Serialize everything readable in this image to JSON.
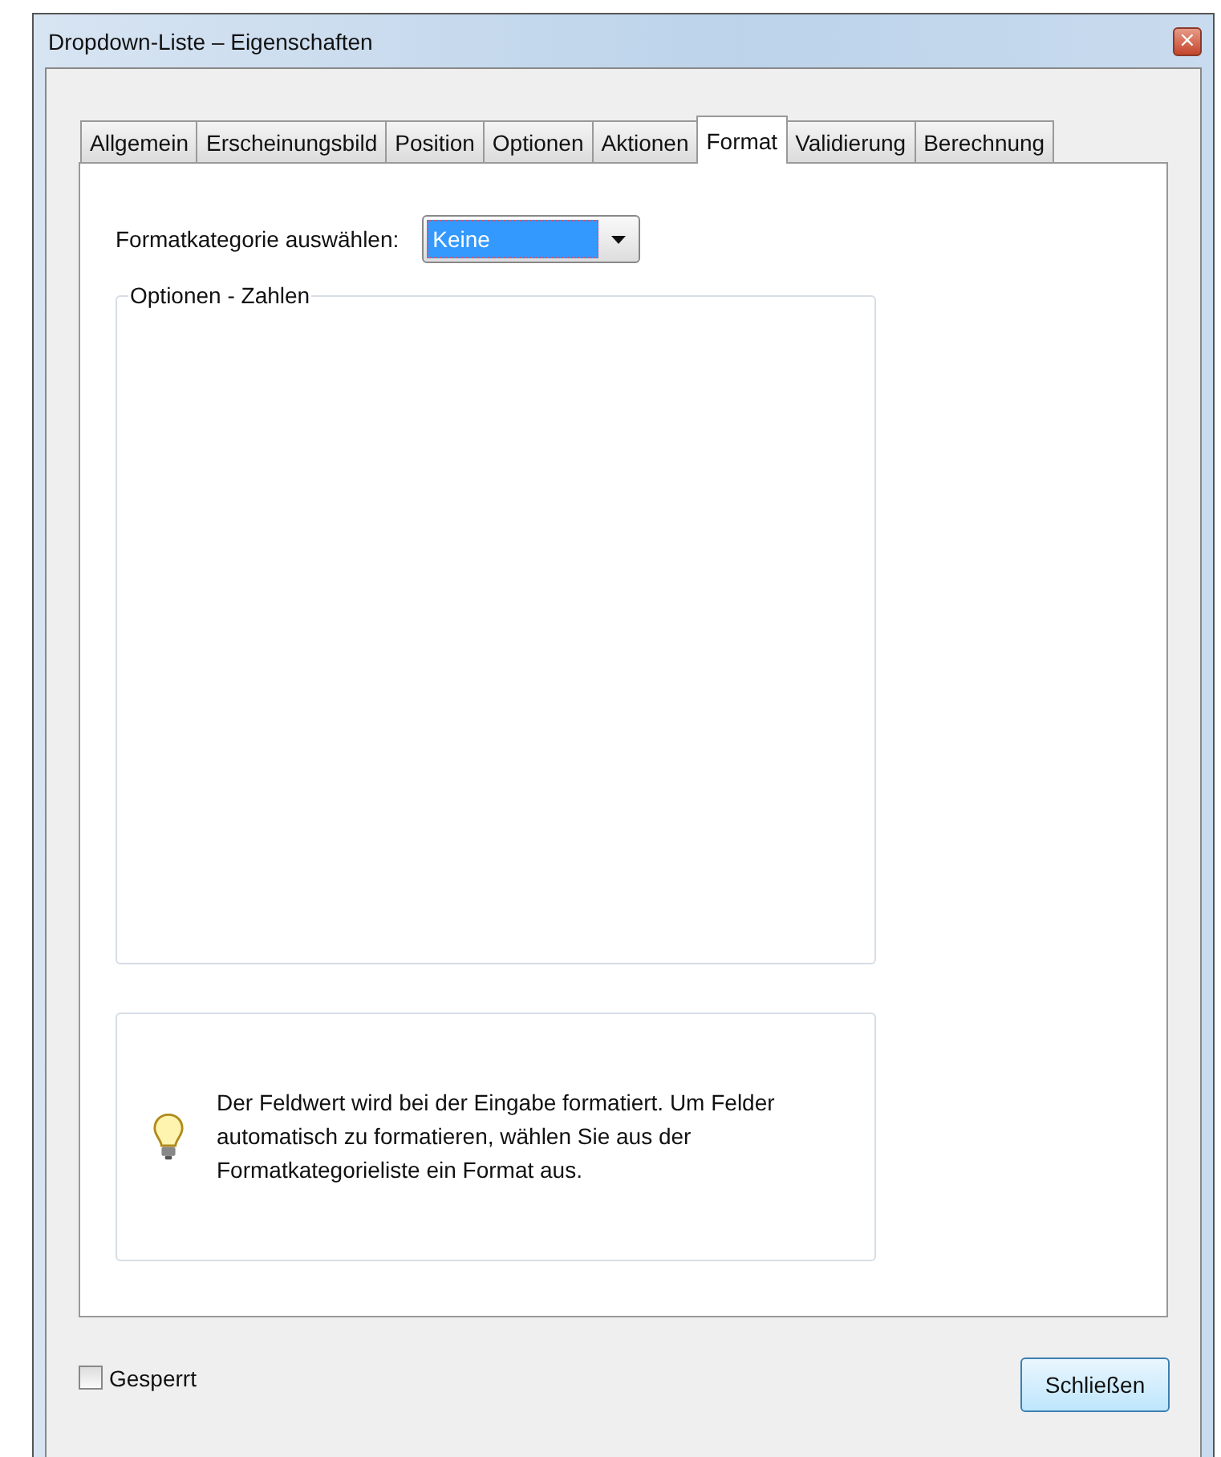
{
  "window": {
    "title": "Dropdown-Liste – Eigenschaften",
    "close_glyph": "×"
  },
  "tabs": [
    {
      "label": "Allgemein",
      "selected": false
    },
    {
      "label": "Erscheinungsbild",
      "selected": false
    },
    {
      "label": "Position",
      "selected": false
    },
    {
      "label": "Optionen",
      "selected": false
    },
    {
      "label": "Aktionen",
      "selected": false
    },
    {
      "label": "Format",
      "selected": true
    },
    {
      "label": "Validierung",
      "selected": false
    },
    {
      "label": "Berechnung",
      "selected": false
    }
  ],
  "format_category": {
    "label": "Formatkategorie auswählen:",
    "value": "Keine"
  },
  "options_group": {
    "title": "Optionen - Zahlen"
  },
  "hint": {
    "text": "Der Feldwert wird bei der Eingabe formatiert. Um Felder automatisch zu formatieren, wählen Sie aus der Formatkategorieliste ein Format aus."
  },
  "locked": {
    "label": "Gesperrt",
    "checked": false
  },
  "buttons": [
    "Schließen"
  ]
}
